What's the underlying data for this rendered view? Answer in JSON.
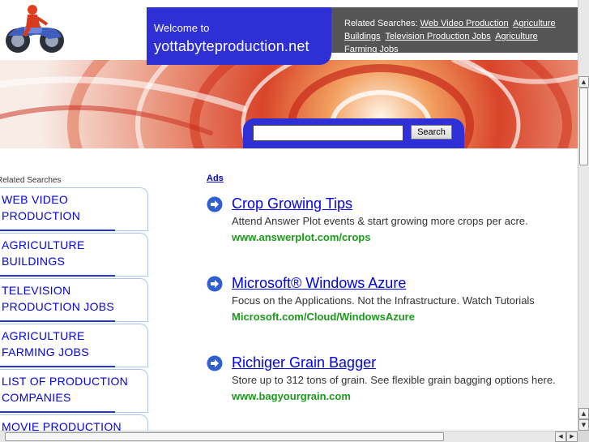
{
  "header": {
    "welcome_label": "Welcome to",
    "domain": "yottabyteproduction.net",
    "related_label": "Related Searches:",
    "related_links": [
      "Web Video Production",
      "Agriculture Buildings",
      "Television Production Jobs",
      "Agriculture Farming Jobs"
    ]
  },
  "search": {
    "placeholder": "",
    "button_label": "Search"
  },
  "sidebar": {
    "title": "Related Searches",
    "items": [
      {
        "line1": "Web Video",
        "line2": "Production"
      },
      {
        "line1": "Agriculture",
        "line2": "Buildings"
      },
      {
        "line1": "Television",
        "line2": "Production Jobs"
      },
      {
        "line1": "Agriculture",
        "line2": "Farming Jobs"
      },
      {
        "line1": "List of Production",
        "line2": "Companies"
      },
      {
        "line1": "Movie Production",
        "line2": ""
      }
    ]
  },
  "ads": {
    "label": "Ads",
    "items": [
      {
        "title": "Crop Growing Tips",
        "desc": "Attend Answer Plot events & start growing more crops per acre.",
        "url": "www.answerplot.com/crops"
      },
      {
        "title": "Microsoft® Windows Azure",
        "desc": "Focus on the Applications. Not the Infrastructure. Watch Tutorials",
        "url": "Microsoft.com/Cloud/WindowsAzure"
      },
      {
        "title": "Richiger Grain Bagger",
        "desc": "Store up to 312 tons of grain. See flexible grain bagging options here.",
        "url": "www.bagyourgrain.com"
      }
    ]
  },
  "colors": {
    "accent_blue": "#2f2fd6",
    "link_blue": "#0000ee",
    "url_green": "#1a9a1a",
    "related_bg": "#555555"
  }
}
